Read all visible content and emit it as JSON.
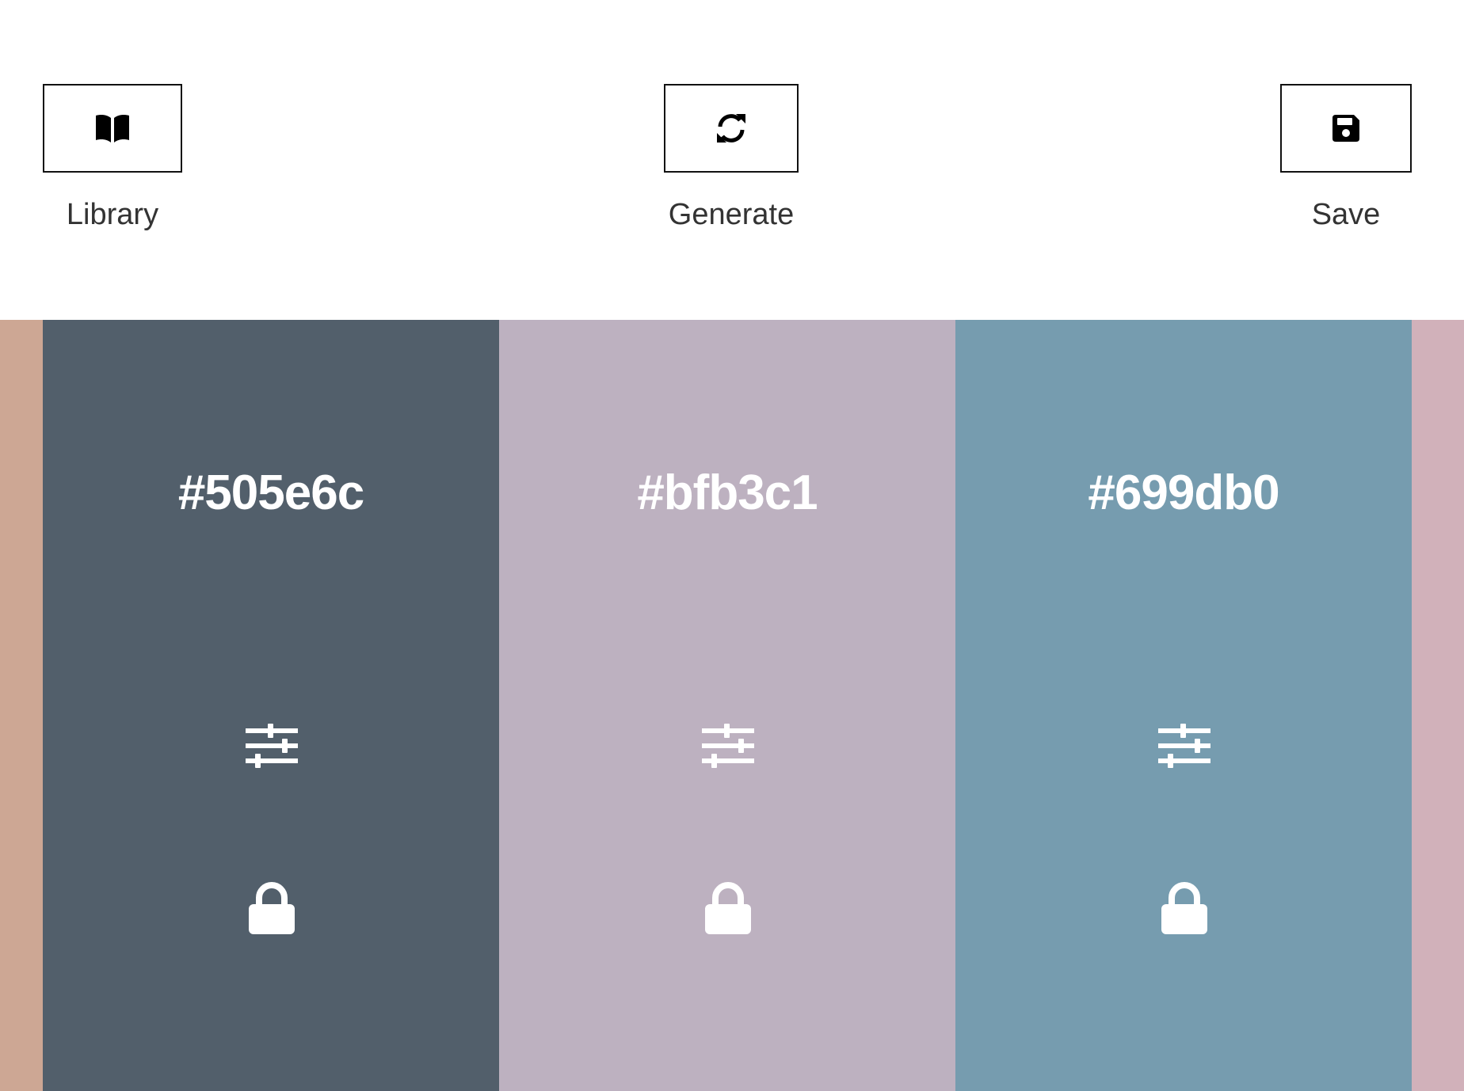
{
  "toolbar": {
    "library": {
      "label": "Library",
      "icon": "book-open-icon"
    },
    "generate": {
      "label": "Generate",
      "icon": "refresh-icon"
    },
    "save": {
      "label": "Save",
      "icon": "floppy-disk-icon"
    }
  },
  "palette": {
    "edges": {
      "left_color": "#cda794",
      "right_color": "#d1b1ba"
    },
    "swatches": [
      {
        "hex": "#505e6c",
        "color": "#525f6b",
        "adjust_icon": "sliders-icon",
        "lock_icon": "lock-icon"
      },
      {
        "hex": "#bfb3c1",
        "color": "#bdb1c0",
        "adjust_icon": "sliders-icon",
        "lock_icon": "lock-icon"
      },
      {
        "hex": "#699db0",
        "color": "#769caf",
        "adjust_icon": "sliders-icon",
        "lock_icon": "lock-icon"
      }
    ]
  }
}
